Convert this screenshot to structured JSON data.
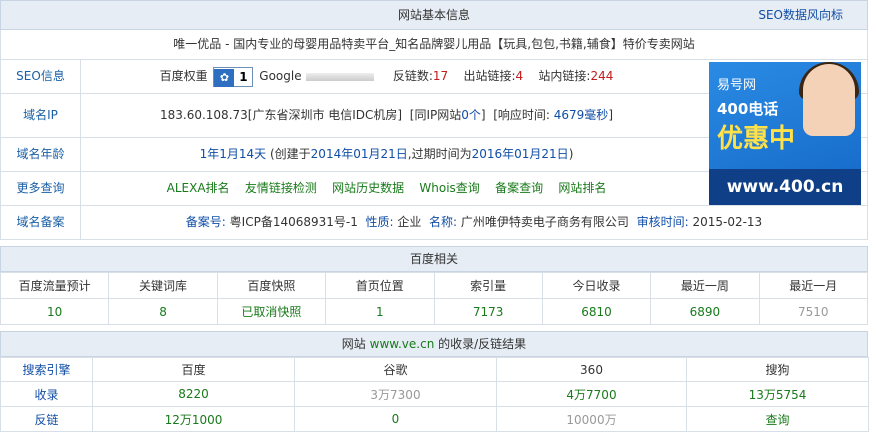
{
  "basic": {
    "title": "网站基本信息",
    "seo_link": "SEO数据风向标",
    "site_desc": "唯一优品 - 国内专业的母婴用品特卖平台_知名品牌婴儿用品【玩具,包包,书籍,辅食】特价专卖网站",
    "seo": {
      "label": "SEO信息",
      "baidu_weight_label": "百度权重",
      "baidu_weight": "1",
      "google_label": "Google",
      "backlinks_label": "反链数:",
      "backlinks": "17",
      "outlinks_label": "出站链接:",
      "outlinks": "4",
      "inlinks_label": "站内链接:",
      "inlinks": "244"
    },
    "ip": {
      "label": "域名IP",
      "value": "183.60.108.73[广东省深圳市 电信IDC机房]",
      "same_ip_prefix": "[同IP网站",
      "same_ip_count": "0个",
      "same_ip_suffix": "]",
      "response_label": "[响应时间:",
      "response_time": "4679毫秒",
      "response_suffix": "]"
    },
    "age": {
      "label": "域名年龄",
      "age": "1年1月14天",
      "created_prefix": "(创建于",
      "created": "2014年01月21日",
      "expire_prefix": ",过期时间为",
      "expire": "2016年01月21日",
      "suffix": ")"
    },
    "more": {
      "label": "更多查询",
      "links": [
        "ALEXA排名",
        "友情链接检测",
        "网站历史数据",
        "Whois查询",
        "备案查询",
        "网站排名"
      ]
    },
    "icp": {
      "label": "域名备案",
      "no_label": "备案号:",
      "no": "粤ICP备14068931号-1",
      "nature_label": "性质:",
      "nature": "企业",
      "name_label": "名称:",
      "name": "广州唯伊特卖电子商务有限公司",
      "date_label": "审核时间:",
      "date": "2015-02-13"
    },
    "ad": {
      "logo": "易号网",
      "tel": "400电话",
      "promo": "优惠中",
      "url": "www.400.cn"
    }
  },
  "baidu": {
    "title": "百度相关",
    "headers": [
      "百度流量预计",
      "关键词库",
      "百度快照",
      "首页位置",
      "索引量",
      "今日收录",
      "最近一周",
      "最近一月"
    ],
    "values": [
      "10",
      "8",
      "已取消快照",
      "1",
      "7173",
      "6810",
      "6890",
      "7510"
    ]
  },
  "index": {
    "title_prefix": "网站",
    "domain": "www.ve.cn",
    "title_suffix": "的收录/反链结果",
    "headers": [
      "搜索引擎",
      "百度",
      "谷歌",
      "360",
      "搜狗"
    ],
    "rows": [
      [
        "收录",
        "8220",
        "3万7300",
        "4万7700",
        "13万5754"
      ],
      [
        "反链",
        "12万1000",
        "0",
        "10000万",
        "查询"
      ]
    ]
  },
  "colors": {
    "link": "#114ea6",
    "green": "#187a1a",
    "red": "#c21c1c",
    "header_bg": "#e6edf5"
  }
}
